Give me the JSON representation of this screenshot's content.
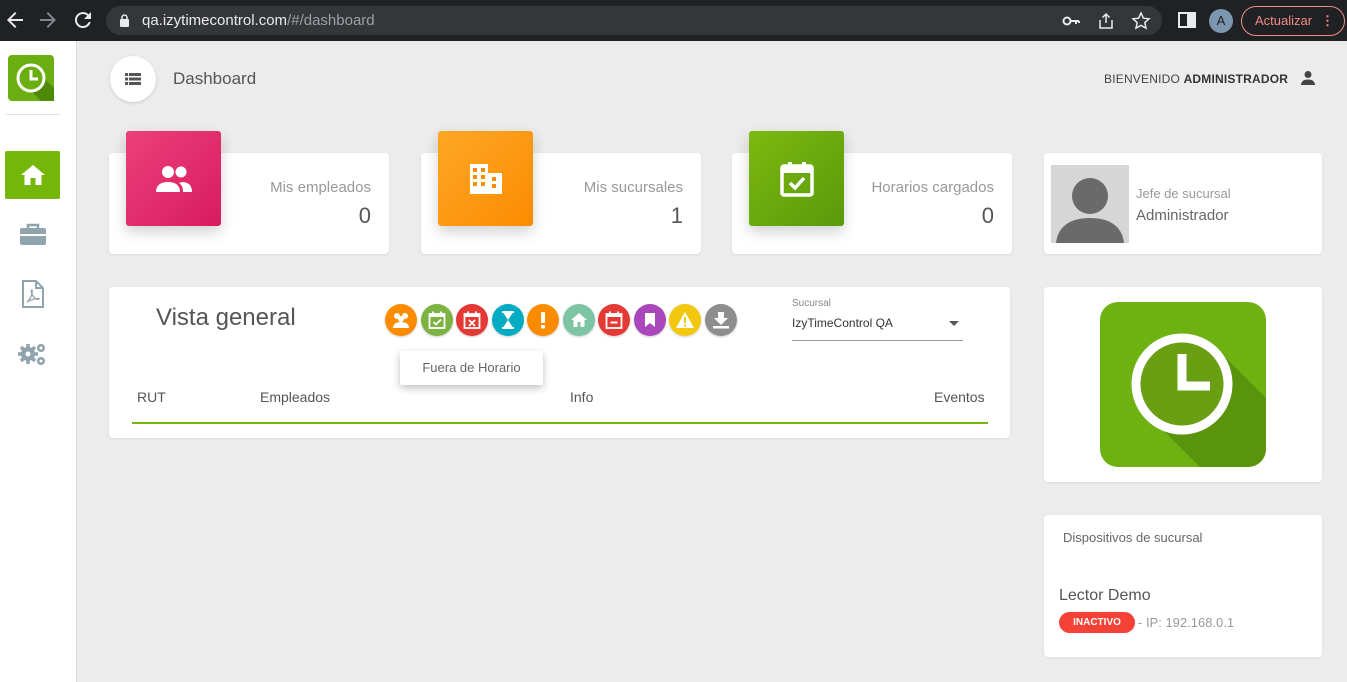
{
  "browser": {
    "url_host": "qa.izytimecontrol.com",
    "url_path": "/#/dashboard",
    "avatar_letter": "A",
    "update_label": "Actualizar"
  },
  "header": {
    "title": "Dashboard",
    "welcome_prefix": "BIENVENIDO",
    "welcome_user": "ADMINISTRADOR"
  },
  "stats": [
    {
      "label": "Mis empleados",
      "value": "0",
      "color": "#e6336f",
      "icon": "people-icon"
    },
    {
      "label": "Mis sucursales",
      "value": "1",
      "color": "#fb8c00",
      "icon": "building-icon"
    },
    {
      "label": "Horarios cargados",
      "value": "0",
      "color": "#6aa70d",
      "icon": "calendar-check-icon"
    }
  ],
  "profile": {
    "role": "Jefe de sucursal",
    "name": "Administrador"
  },
  "overview": {
    "title": "Vista general",
    "tooltip": "Fuera de Horario",
    "branch_label": "Sucursal",
    "branch_value": "IzyTimeControl QA",
    "columns": [
      "RUT",
      "Empleados",
      "Info",
      "Eventos"
    ],
    "filters": [
      {
        "icon": "group-icon",
        "color": "#fb8c00"
      },
      {
        "icon": "calendar-check-icon",
        "color": "#7cb342"
      },
      {
        "icon": "calendar-x-icon",
        "color": "#e53935"
      },
      {
        "icon": "hourglass-icon",
        "color": "#00acc1"
      },
      {
        "icon": "exclamation-icon",
        "color": "#fb8c00"
      },
      {
        "icon": "home-icon",
        "color": "#7cc4a4"
      },
      {
        "icon": "calendar-minus-icon",
        "color": "#e53935"
      },
      {
        "icon": "bookmark-icon",
        "color": "#ab47bc"
      },
      {
        "icon": "warning-icon",
        "color": "#f2c80f"
      },
      {
        "icon": "download-icon",
        "color": "#8e8e8e"
      }
    ]
  },
  "devices": {
    "title": "Dispositivos de sucursal",
    "items": [
      {
        "name": "Lector Demo",
        "status": "INACTIVO",
        "ip": "- IP: 192.168.0.1"
      }
    ]
  },
  "colors": {
    "accent": "#75b60a",
    "inactive": "#f44336"
  }
}
